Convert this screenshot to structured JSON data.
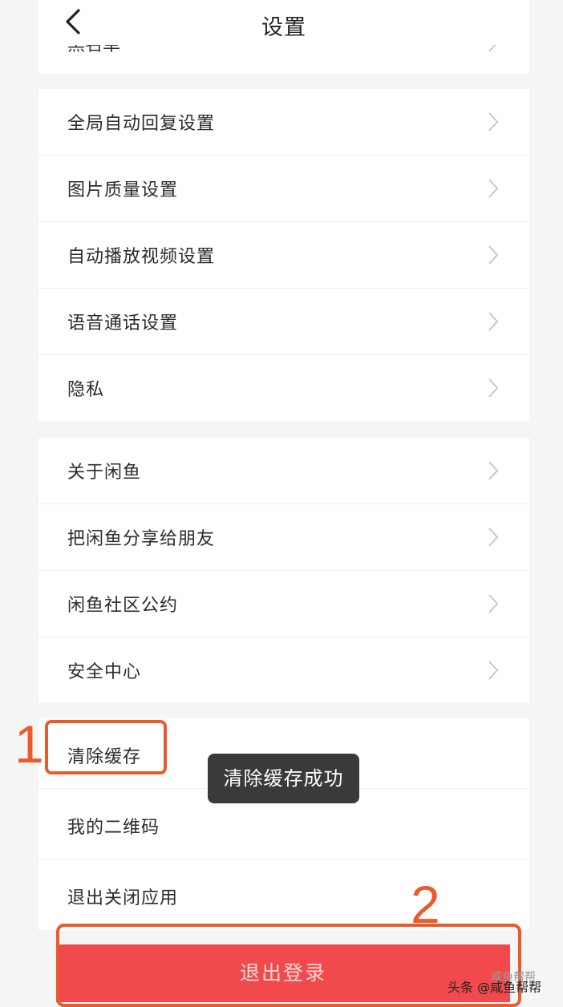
{
  "header": {
    "title": "设置"
  },
  "partial_row": {
    "label": "黑名单"
  },
  "groups": [
    {
      "items": [
        {
          "label": "全局自动回复设置"
        },
        {
          "label": "图片质量设置"
        },
        {
          "label": "自动播放视频设置"
        },
        {
          "label": "语音通话设置"
        },
        {
          "label": "隐私"
        }
      ]
    },
    {
      "items": [
        {
          "label": "关于闲鱼"
        },
        {
          "label": "把闲鱼分享给朋友"
        },
        {
          "label": "闲鱼社区公约"
        },
        {
          "label": "安全中心"
        }
      ]
    },
    {
      "items": [
        {
          "label": "清除缓存"
        },
        {
          "label": "我的二维码"
        },
        {
          "label": "退出关闭应用"
        }
      ]
    }
  ],
  "logout_label": "退出登录",
  "toast": "清除缓存成功",
  "annotations": {
    "step1": "1",
    "step2": "2"
  },
  "watermark": {
    "text": "头条 @咸鱼帮帮",
    "faint": "咸鱼帮帮"
  },
  "colors": {
    "accent": "#f24a4c",
    "annotation": "#ea5b2c"
  }
}
